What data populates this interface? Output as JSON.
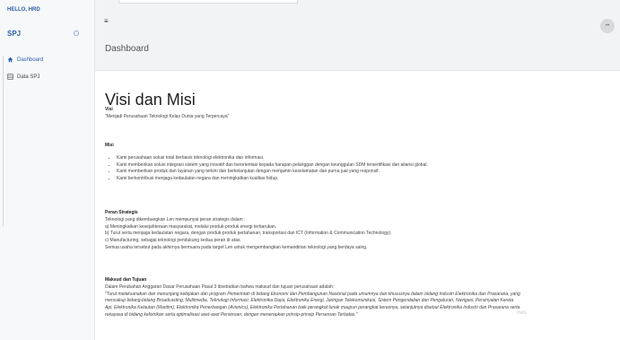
{
  "sidebar": {
    "greeting": "HELLO, HRD",
    "brand": "SPJ",
    "items": [
      {
        "label": "Dashboard"
      },
      {
        "label": "Data SPJ"
      }
    ]
  },
  "header": {
    "menu_icon": "hamburger-icon"
  },
  "page": {
    "title": "Dashboard"
  },
  "content": {
    "heading": "Visi dan Misi",
    "visi_title": "Visi",
    "visi_text": "\"Menjadi Perusahaan Teknologi Kelas Dunia yang Terpercaya\"",
    "misi_title": "Misi",
    "misi_items": [
      "Kami perusahaan solusi total berbasis teknologi elektronika dan informasi.",
      "Kami memberikan solusi integrasi sistem yang inovatif dan berorientasi kepada harapan pelanggan dengan keunggulan SDM tersertifikasi dan aliansi global.",
      "Kami memberikan produk dan layanan yang terkini dan berkelanjutan dengan menjamin keselamatan dan purna jual yang responsif.",
      "Kami berkontribusi menjaga kedaulatan negara dan meningkatkan kualitas hidup."
    ],
    "peran_title": "Peran Strategis",
    "peran_lines": [
      "Teknologi yang dikembangkan Len mempunyai peran strategis dalam :",
      "a) Meningkatkan kesejahteraan masyarakat, melalui produk-produk energi terbarukan.",
      "b) Turut serta menjaga kedaulatan negara, dengan produk-produk pertahanan, transportasi dan ICT (Information & Communication Technology).",
      "c) Manufacturing, sebagai teknologi pendukung kedua peran di atas.",
      "Semua usaha tersebut pada akhirnya bermuara pada target Len untuk mengembangkan kemandirian teknologi yang berdaya saing."
    ],
    "maksud_title": "Maksud dan Tujuan",
    "maksud_intro": "Dalam Perubahan Anggaran Dasar Perusahaan Pasal 3 disebutkan bahwa maksud dan tujuan perusahaan adalah:",
    "maksud_quote_lines": [
      "\"Turut melaksanakan dan menunjang kebijakan dan program Pemerintah di bidang Ekonomi dan Pembangunan Nasional pada umumnya dan khususnya dalam bidang Industri Elektronika dan Prasarana, yang",
      "mencakup bidang-bidang Broadcasting, Multimedia, Teknologi Informasi, Elektronika Daya, Elektronika Energi, Jaringan Telekomunikasi, Sistem Pengendalian dan Pengaturan, Navigasi, Persinyalan Kereta",
      "Api, Elektronika Kelautan (Maritim), Elektronika Penerbangan (Avionics), Elektronika Pertahanan baik perangkat lunak maupun perangkat kerasnya, selanjutnya disebut Elektronika Industri dan Prasarana serta",
      "rekayasa di bidang kelistrikan serta optimalisasi aset-aset Perseroan, dengan menerapkan prinsip-prinsip Perseroan Terbatas.\""
    ],
    "watermark": "ows"
  }
}
